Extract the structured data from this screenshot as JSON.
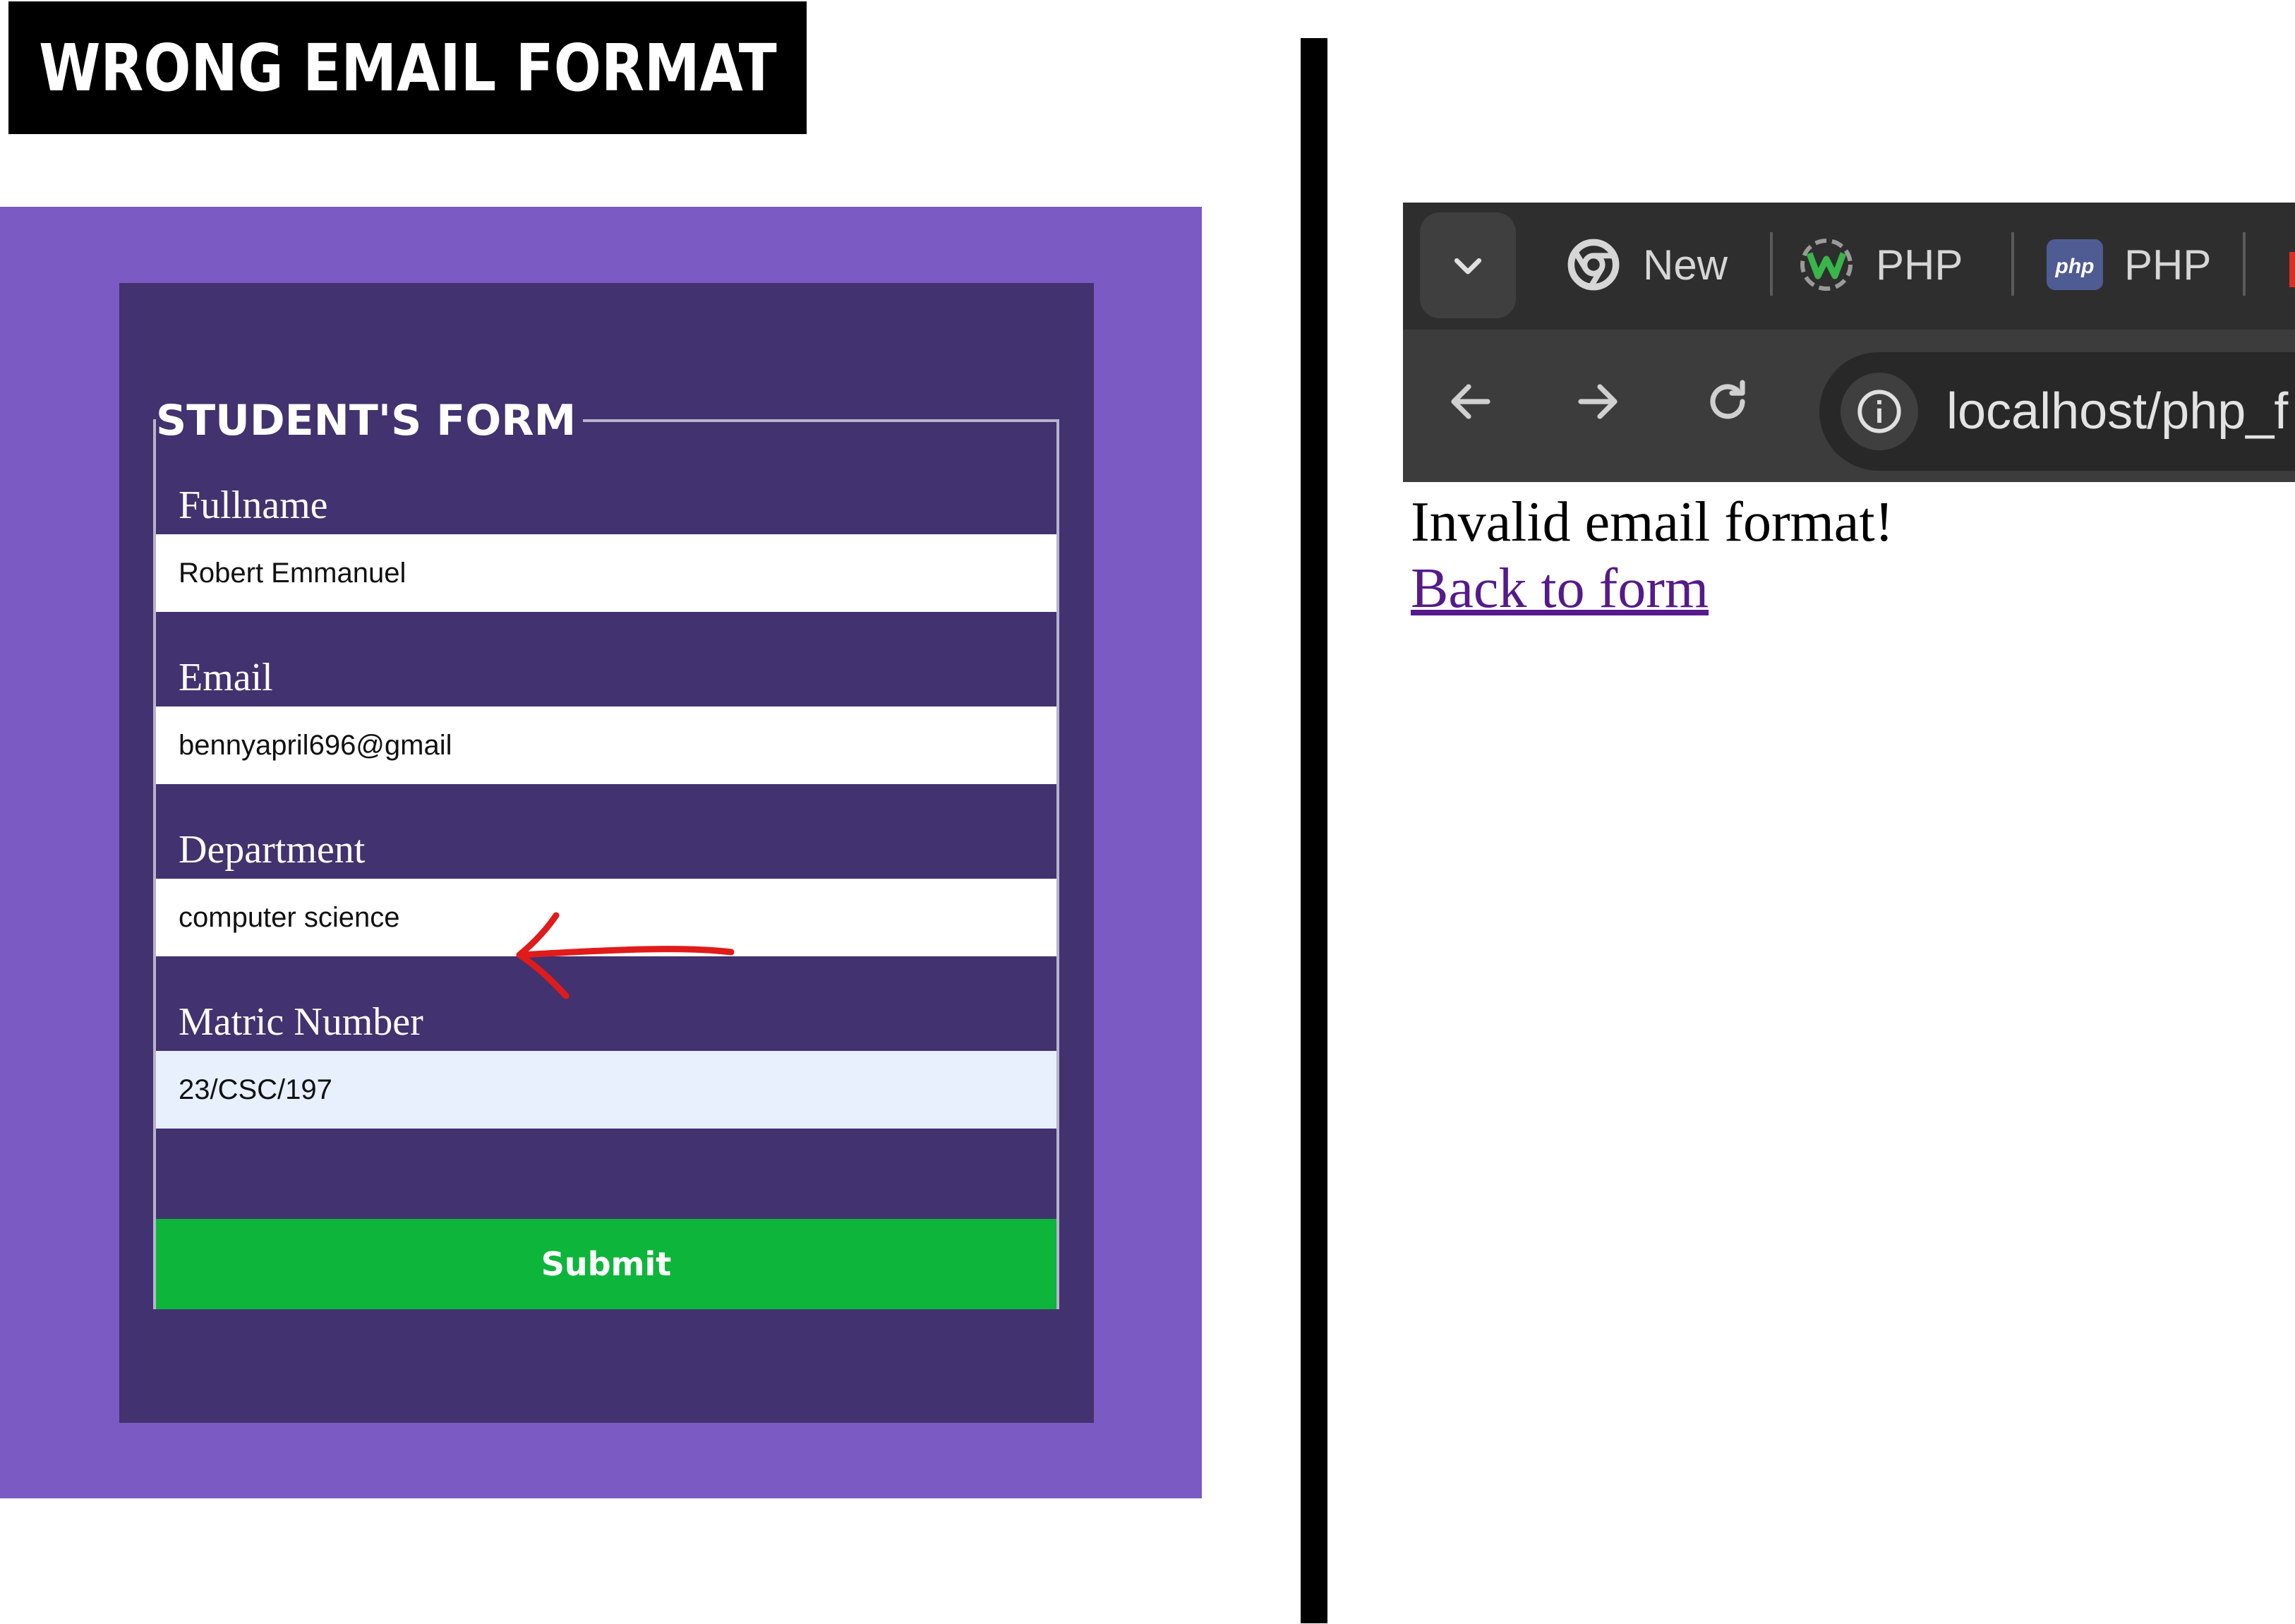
{
  "heading": "WRONG EMAIL FORMAT",
  "form": {
    "legend": "STUDENT'S FORM",
    "fields": [
      {
        "label": "Fullname",
        "value": "Robert Emmanuel"
      },
      {
        "label": "Email",
        "value": "bennyapril696@gmail"
      },
      {
        "label": "Department",
        "value": "computer science"
      },
      {
        "label": "Matric Number",
        "value": "23/CSC/197"
      }
    ],
    "submit_label": "Submit"
  },
  "browser": {
    "tabs": [
      {
        "label": "New",
        "icon": "chrome-icon"
      },
      {
        "label": "PHP",
        "icon": "wamp-icon"
      },
      {
        "label": "PHP",
        "icon": "php-icon"
      }
    ],
    "url": "localhost/php_f"
  },
  "result": {
    "message": "Invalid email format!",
    "link_text": "Back to form"
  },
  "colors": {
    "outer_bg": "#7b5ac3",
    "inner_bg": "#42326f",
    "submit": "#0db53a",
    "annotation_arrow": "#e01b1b",
    "link": "#551a8b"
  }
}
